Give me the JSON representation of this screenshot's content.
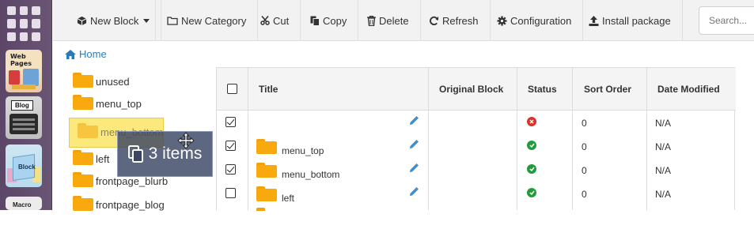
{
  "dock": {
    "apps": [
      {
        "label": "Web Pages"
      },
      {
        "label": "Blog"
      },
      {
        "label": "Block"
      },
      {
        "label": "Macro"
      }
    ]
  },
  "toolbar": {
    "new_block": "New Block",
    "new_category": "New Category",
    "cut": "Cut",
    "copy": "Copy",
    "delete": "Delete",
    "refresh": "Refresh",
    "configuration": "Configuration",
    "install_package": "Install package",
    "search_placeholder": "Search..."
  },
  "breadcrumb": {
    "home": "Home"
  },
  "tree": {
    "items": [
      "unused",
      "menu_top",
      "menu_bottom",
      "left",
      "frontpage_blurb",
      "frontpage_blog"
    ]
  },
  "drag": {
    "label": "3 items",
    "ghost_label": "menu_bottom"
  },
  "table": {
    "headers": {
      "title": "Title",
      "original_block": "Original Block",
      "status": "Status",
      "sort_order": "Sort Order",
      "date_modified": "Date Modified"
    },
    "rows": [
      {
        "checked": true,
        "title": "",
        "is_folder": false,
        "status": "inactive",
        "sort_order": "0",
        "date_modified": "N/A"
      },
      {
        "checked": true,
        "title": "menu_top",
        "is_folder": true,
        "status": "active",
        "sort_order": "0",
        "date_modified": "N/A"
      },
      {
        "checked": true,
        "title": "menu_bottom",
        "is_folder": true,
        "status": "active",
        "sort_order": "0",
        "date_modified": "N/A"
      },
      {
        "checked": false,
        "title": "left",
        "is_folder": true,
        "status": "active",
        "sort_order": "0",
        "date_modified": "N/A"
      }
    ]
  },
  "colors": {
    "accent": "#2a7ab7",
    "folder": "#f7a90e",
    "active": "#1f9d3a",
    "inactive": "#d9342b",
    "selection": "#fbe97d",
    "drag_overlay": "#3a4664"
  }
}
